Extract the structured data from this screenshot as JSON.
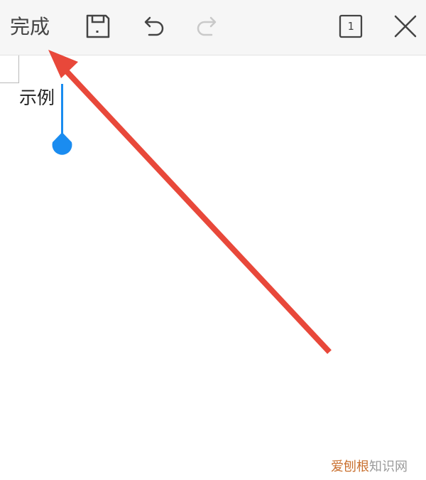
{
  "toolbar": {
    "done_label": "完成",
    "icons": {
      "save": "save-icon",
      "undo": "undo-icon",
      "redo": "redo-icon",
      "pages": "page-count-icon",
      "close": "close-icon"
    },
    "page_count": "1",
    "redo_enabled": false
  },
  "document": {
    "text": "示例"
  },
  "annotation": {
    "arrow_color": "#e8483a"
  },
  "colors": {
    "cursor_handle": "#1a8cf0",
    "toolbar_bg": "#f6f6f6",
    "icon": "#444444",
    "icon_disabled": "#c9c9c9"
  },
  "watermark": {
    "part1": "爱刨根",
    "part2": "知识网"
  }
}
